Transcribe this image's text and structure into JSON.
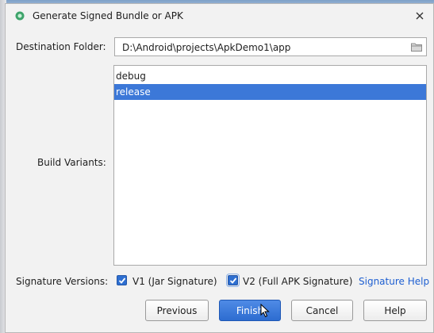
{
  "dialog": {
    "title": "Generate Signed Bundle or APK",
    "close_icon": "close-icon"
  },
  "destination": {
    "label": "Destination Folder:",
    "value": "D:\\Android\\projects\\ApkDemo1\\app",
    "icon": "folder-icon"
  },
  "build_variants": {
    "label": "Build Variants:",
    "items": [
      {
        "label": "debug",
        "selected": false
      },
      {
        "label": "release",
        "selected": true
      }
    ]
  },
  "signature": {
    "label": "Signature Versions:",
    "v1": {
      "label": "V1 (Jar Signature)",
      "checked": true
    },
    "v2": {
      "label": "V2 (Full APK Signature)",
      "checked": true
    },
    "help_link": "Signature Help"
  },
  "buttons": {
    "previous": "Previous",
    "finish": "Finish",
    "cancel": "Cancel",
    "help": "Help"
  },
  "colors": {
    "selection": "#3c78d8",
    "primary_button": "#2d6cd0",
    "link": "#1e5fd1"
  }
}
